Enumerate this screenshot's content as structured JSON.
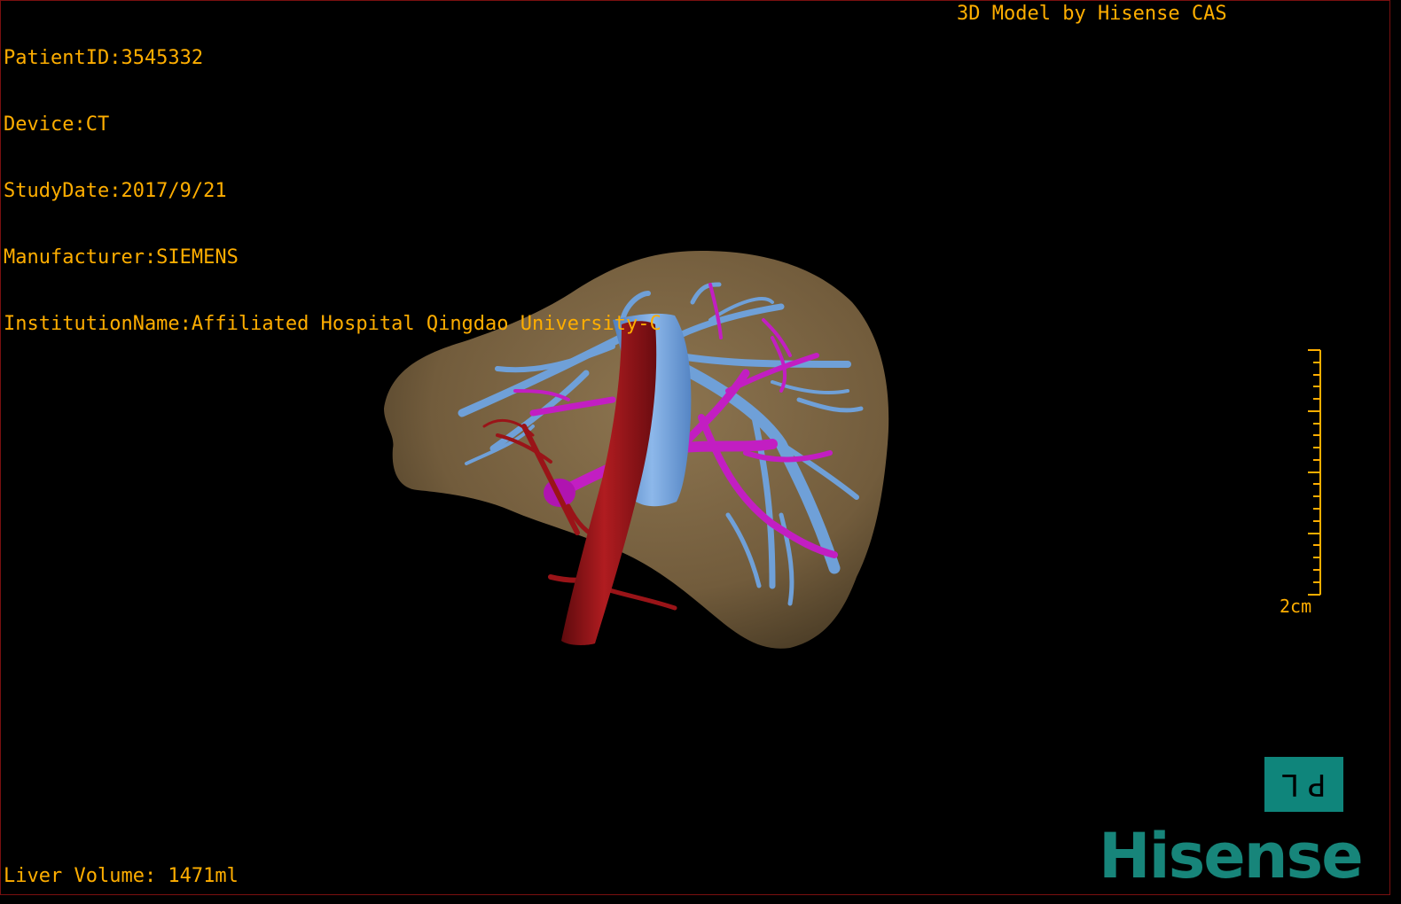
{
  "header": {
    "patient_id": "PatientID:3545332",
    "device": "Device:CT",
    "study_date": "StudyDate:2017/9/21",
    "manufacturer": "Manufacturer:SIEMENS",
    "institution": "InstitutionName:Affiliated Hospital Qingdao University-C",
    "credit": "3D Model by Hisense CAS"
  },
  "footer": {
    "liver_volume": "Liver Volume: 1471ml"
  },
  "scale": {
    "label": "2cm"
  },
  "orientation": {
    "left_glyph": "L",
    "right_glyph": "P"
  },
  "brand": {
    "logo_text": "Hisense"
  },
  "colors": {
    "overlay_text": "#ffae00",
    "liver": "#7a6441",
    "hepatic_vein": "#6fa0d8",
    "portal_vein": "#c21ec2",
    "artery_ivc": "#a1161a",
    "brand": "#17857a"
  }
}
